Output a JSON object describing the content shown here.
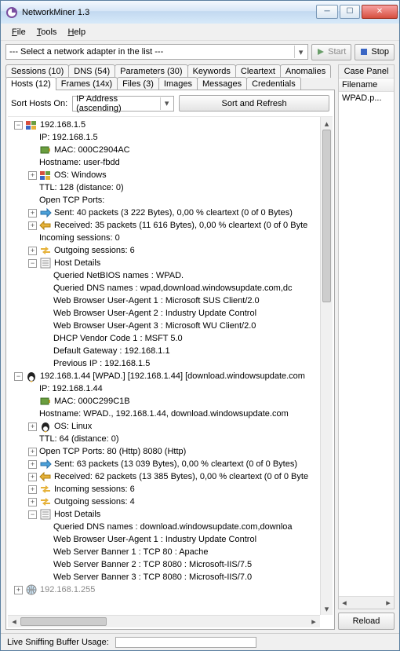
{
  "window": {
    "title": "NetworkMiner 1.3"
  },
  "menu": {
    "file": "File",
    "tools": "Tools",
    "help": "Help"
  },
  "toolbar": {
    "adapter_placeholder": "--- Select a network adapter in the list ---",
    "start": "Start",
    "stop": "Stop"
  },
  "tabs_row1": [
    "Sessions (10)",
    "DNS (54)",
    "Parameters (30)",
    "Keywords",
    "Cleartext",
    "Anomalies"
  ],
  "tabs_row2": [
    "Hosts (12)",
    "Frames (14x)",
    "Files (3)",
    "Images",
    "Messages",
    "Credentials"
  ],
  "sort": {
    "label": "Sort Hosts On:",
    "value": "IP Address (ascending)",
    "button": "Sort and Refresh"
  },
  "tree": [
    {
      "depth": 0,
      "tw": "-",
      "icon": "win",
      "text": "192.168.1.5"
    },
    {
      "depth": 1,
      "tw": "",
      "icon": "",
      "text": "IP: 192.168.1.5"
    },
    {
      "depth": 1,
      "tw": "",
      "icon": "nic",
      "text": "MAC: 000C2904AC"
    },
    {
      "depth": 1,
      "tw": "",
      "icon": "",
      "text": "Hostname: user-fbdd"
    },
    {
      "depth": 1,
      "tw": "+",
      "icon": "win",
      "text": "OS: Windows"
    },
    {
      "depth": 1,
      "tw": "",
      "icon": "",
      "text": "TTL: 128 (distance: 0)"
    },
    {
      "depth": 1,
      "tw": "",
      "icon": "",
      "text": "Open TCP Ports:"
    },
    {
      "depth": 1,
      "tw": "+",
      "icon": "out",
      "text": "Sent: 40 packets (3 222 Bytes), 0,00 % cleartext (0 of 0 Bytes)"
    },
    {
      "depth": 1,
      "tw": "+",
      "icon": "in",
      "text": "Received: 35 packets (11 616 Bytes), 0,00 % cleartext (0 of 0 Byte"
    },
    {
      "depth": 1,
      "tw": "",
      "icon": "",
      "text": "Incoming sessions: 0"
    },
    {
      "depth": 1,
      "tw": "+",
      "icon": "sess",
      "text": "Outgoing sessions: 6"
    },
    {
      "depth": 1,
      "tw": "-",
      "icon": "det",
      "text": "Host Details"
    },
    {
      "depth": 2,
      "tw": "",
      "icon": "",
      "text": "Queried NetBIOS names : WPAD."
    },
    {
      "depth": 2,
      "tw": "",
      "icon": "",
      "text": "Queried DNS names : wpad,download.windowsupdate.com,dc"
    },
    {
      "depth": 2,
      "tw": "",
      "icon": "",
      "text": "Web Browser User-Agent 1 : Microsoft SUS Client/2.0"
    },
    {
      "depth": 2,
      "tw": "",
      "icon": "",
      "text": "Web Browser User-Agent 2 : Industry Update Control"
    },
    {
      "depth": 2,
      "tw": "",
      "icon": "",
      "text": "Web Browser User-Agent 3 : Microsoft WU Client/2.0"
    },
    {
      "depth": 2,
      "tw": "",
      "icon": "",
      "text": "DHCP Vendor Code 1 : MSFT 5.0"
    },
    {
      "depth": 2,
      "tw": "",
      "icon": "",
      "text": "Default Gateway : 192.168.1.1"
    },
    {
      "depth": 2,
      "tw": "",
      "icon": "",
      "text": "Previous IP : 192.168.1.5"
    },
    {
      "depth": 0,
      "tw": "-",
      "icon": "tux",
      "text": "192.168.1.44 [WPAD.] [192.168.1.44] [download.windowsupdate.com"
    },
    {
      "depth": 1,
      "tw": "",
      "icon": "",
      "text": "IP: 192.168.1.44"
    },
    {
      "depth": 1,
      "tw": "",
      "icon": "nic",
      "text": "MAC: 000C299C1B"
    },
    {
      "depth": 1,
      "tw": "",
      "icon": "",
      "text": "Hostname: WPAD., 192.168.1.44, download.windowsupdate.com"
    },
    {
      "depth": 1,
      "tw": "+",
      "icon": "tux",
      "text": "OS: Linux"
    },
    {
      "depth": 1,
      "tw": "",
      "icon": "",
      "text": "TTL: 64 (distance: 0)"
    },
    {
      "depth": 1,
      "tw": "+",
      "icon": "",
      "text": "Open TCP Ports: 80 (Http) 8080 (Http)"
    },
    {
      "depth": 1,
      "tw": "+",
      "icon": "out",
      "text": "Sent: 63 packets (13 039 Bytes), 0,00 % cleartext (0 of 0 Bytes)"
    },
    {
      "depth": 1,
      "tw": "+",
      "icon": "in",
      "text": "Received: 62 packets (13 385 Bytes), 0,00 % cleartext (0 of 0 Byte"
    },
    {
      "depth": 1,
      "tw": "+",
      "icon": "sess",
      "text": "Incoming sessions: 6"
    },
    {
      "depth": 1,
      "tw": "+",
      "icon": "sess",
      "text": "Outgoing sessions: 4"
    },
    {
      "depth": 1,
      "tw": "-",
      "icon": "det",
      "text": "Host Details"
    },
    {
      "depth": 2,
      "tw": "",
      "icon": "",
      "text": "Queried DNS names : download.windowsupdate.com,downloa"
    },
    {
      "depth": 2,
      "tw": "",
      "icon": "",
      "text": "Web Browser User-Agent 1 : Industry Update Control"
    },
    {
      "depth": 2,
      "tw": "",
      "icon": "",
      "text": "Web Server Banner 1 : TCP 80 : Apache"
    },
    {
      "depth": 2,
      "tw": "",
      "icon": "",
      "text": "Web Server Banner 2 : TCP 8080 : Microsoft-IIS/7.5"
    },
    {
      "depth": 2,
      "tw": "",
      "icon": "",
      "text": "Web Server Banner 3 : TCP 8080 : Microsoft-IIS/7.0"
    },
    {
      "depth": 0,
      "tw": "+",
      "icon": "globe",
      "text": "192.168.1.255",
      "gray": true
    }
  ],
  "case_panel": {
    "title": "Case Panel",
    "col": "Filename",
    "items": [
      "WPAD.p..."
    ],
    "reload": "Reload"
  },
  "status": {
    "label": "Live Sniffing Buffer Usage:"
  }
}
